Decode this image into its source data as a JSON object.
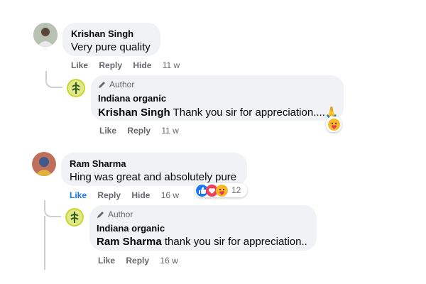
{
  "comments": [
    {
      "author": "Krishan Singh",
      "text": "Very pure quality",
      "actions": {
        "like": "Like",
        "reply": "Reply",
        "hide": "Hide",
        "time": "11 w"
      },
      "reply": {
        "badge": "Author",
        "author": "Indiana organic",
        "mention": "Krishan Singh",
        "text": "Thank you sir for appreciation....🙏",
        "actions": {
          "like": "Like",
          "reply": "Reply",
          "time": "11 w"
        },
        "reaction": "care-icon"
      }
    },
    {
      "author": "Ram Sharma",
      "text": "Hing was great and absolutely pure",
      "actions": {
        "like": "Like",
        "reply": "Reply",
        "hide": "Hide",
        "time": "16 w"
      },
      "reactions": {
        "icons": [
          "like-icon",
          "love-icon",
          "care-icon"
        ],
        "count": "12"
      },
      "reply": {
        "badge": "Author",
        "author": "Indiana organic",
        "mention": "Ram Sharma",
        "text": "thank you sir for appreciation..",
        "actions": {
          "like": "Like",
          "reply": "Reply",
          "time": "16 w"
        }
      }
    }
  ],
  "colors": {
    "bubble": "#f0f2f5",
    "action": "#65676b",
    "liked": "#1877f2"
  }
}
